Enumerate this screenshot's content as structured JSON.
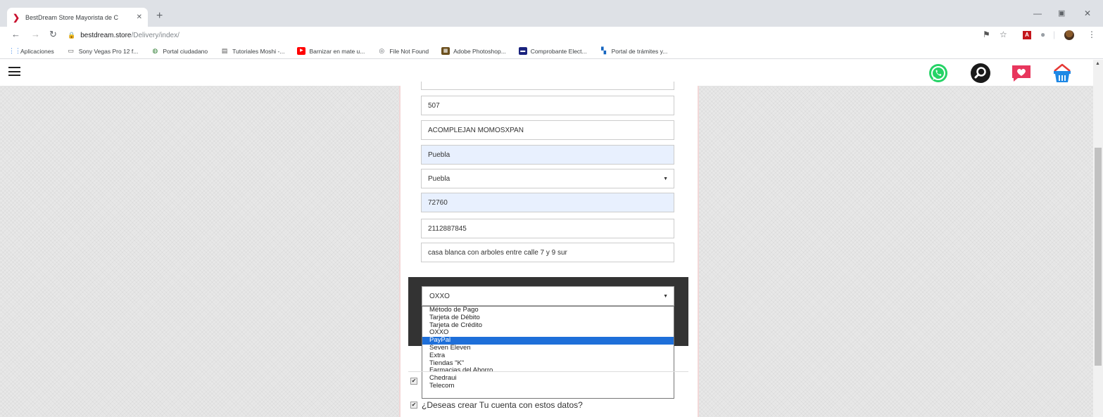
{
  "browser": {
    "tab_title": "BestDream Store Mayorista de C",
    "tab_close": "✕",
    "new_tab": "+",
    "url_host": "bestdream.store",
    "url_path": "/Delivery/index/",
    "bookmarks": [
      {
        "label": "Aplicaciones",
        "icon": "apps-grid-icon",
        "color": "#1a73e8"
      },
      {
        "label": "Sony Vegas Pro 12 f...",
        "icon": "folder-icon",
        "color": "#555555"
      },
      {
        "label": "Portal ciudadano",
        "icon": "seal-icon",
        "color": "#2e7d32"
      },
      {
        "label": "Tutoriales Moshi -...",
        "icon": "page-icon",
        "color": "#555555"
      },
      {
        "label": "Barnizar en mate u...",
        "icon": "youtube-icon",
        "color": "#ff0000"
      },
      {
        "label": "File Not Found",
        "icon": "globe-icon",
        "color": "#5f6368"
      },
      {
        "label": "Adobe Photoshop...",
        "icon": "image-icon",
        "color": "#6b4f1d"
      },
      {
        "label": "Comprobante Elect...",
        "icon": "monitor-icon",
        "color": "#1a237e"
      },
      {
        "label": "Portal de trámites y...",
        "icon": "grid-icon",
        "color": "#1565c0"
      }
    ]
  },
  "form": {
    "number": "507",
    "colony": "ACOMPLEJAN MOMOSXPAN",
    "state": "Puebla",
    "city": "Puebla",
    "zip": "72760",
    "phone": "2112887845",
    "reference": "casa blanca con arboles entre calle 7 y 9 sur"
  },
  "payment": {
    "selected": "OXXO",
    "options": [
      "Método de Pago",
      "Tarjeta de Débito",
      "Tarjeta de Crédito",
      "OXXO",
      "PayPal",
      "Seven Eleven",
      "Extra",
      "Tiendas \"K\"",
      "Farmacias del Ahorro",
      "Chedraui",
      "Telecom"
    ],
    "highlighted_index": 4
  },
  "create_account_label": "¿Deseas crear Tu cuenta con estos datos?",
  "colors": {
    "whatsapp": "#25d366",
    "heart": "#e8365d",
    "cart": "#1e88e5",
    "highlight": "#1e6fd9"
  }
}
